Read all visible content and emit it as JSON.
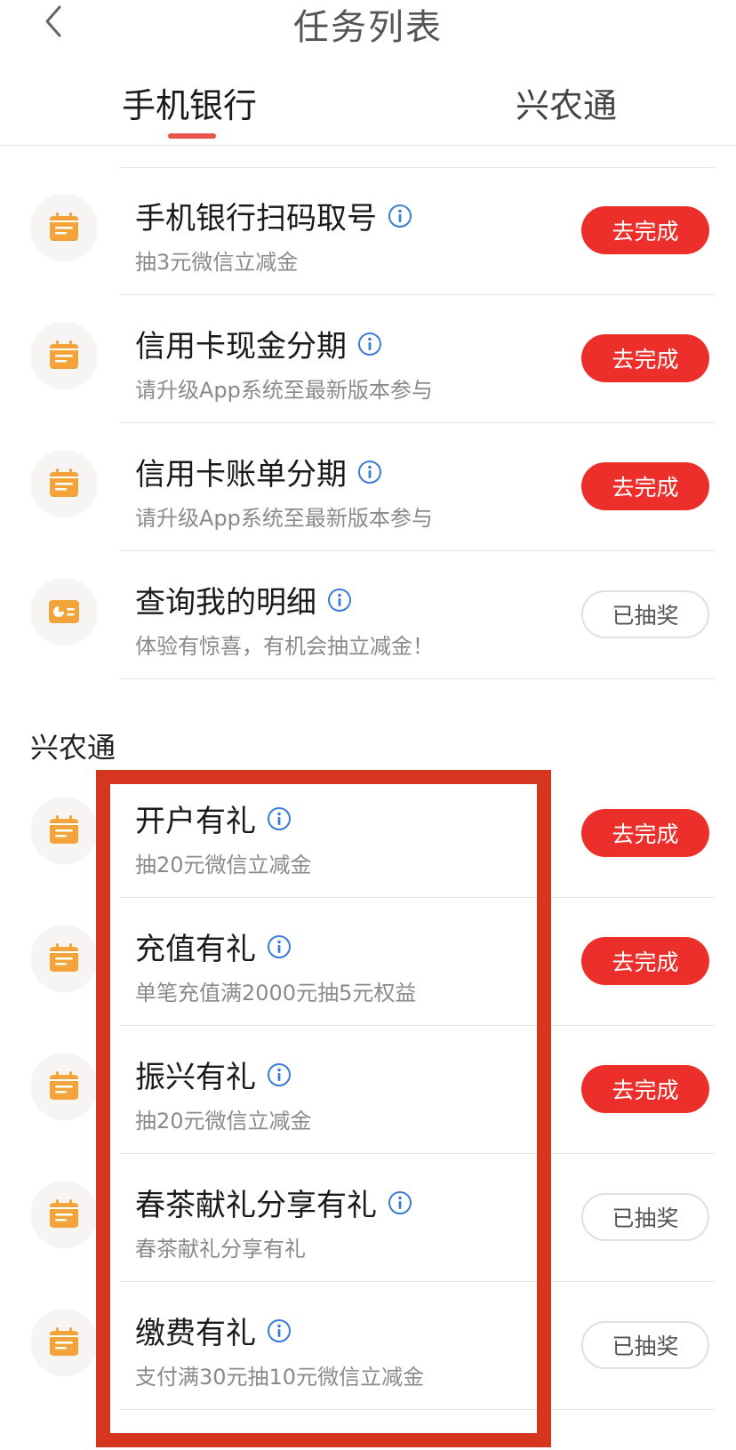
{
  "header": {
    "title": "任务列表"
  },
  "tabs": [
    {
      "label": "手机银行"
    },
    {
      "label": "兴农通"
    }
  ],
  "section_xnt": {
    "title": "兴农通"
  },
  "colors": {
    "accent": "#ec2f2b",
    "icon_orange": "#f2a43a",
    "highlight": "#d4361f"
  },
  "tasks": [
    {
      "title": "手机银行扫码取号",
      "subtitle": "抽3元微信立减金",
      "button": "去完成",
      "icon": "calendar-icon"
    },
    {
      "title": "信用卡现金分期",
      "subtitle": "请升级App系统至最新版本参与",
      "button": "去完成",
      "icon": "calendar-icon"
    },
    {
      "title": "信用卡账单分期",
      "subtitle": "请升级App系统至最新版本参与",
      "button": "去完成",
      "icon": "calendar-icon"
    },
    {
      "title": "查询我的明细",
      "subtitle": "体验有惊喜，有机会抽立减金！",
      "button": "已抽奖",
      "icon": "chart-card-icon"
    },
    {
      "title": "开户有礼",
      "subtitle": "抽20元微信立减金",
      "button": "去完成",
      "icon": "calendar-icon"
    },
    {
      "title": "充值有礼",
      "subtitle": "单笔充值满2000元抽5元权益",
      "button": "去完成",
      "icon": "calendar-icon"
    },
    {
      "title": "振兴有礼",
      "subtitle": "抽20元微信立减金",
      "button": "去完成",
      "icon": "calendar-icon"
    },
    {
      "title": "春茶献礼分享有礼",
      "subtitle": "春茶献礼分享有礼",
      "button": "已抽奖",
      "icon": "calendar-icon"
    },
    {
      "title": "缴费有礼",
      "subtitle": "支付满30元抽10元微信立减金",
      "button": "已抽奖",
      "icon": "calendar-icon"
    }
  ]
}
